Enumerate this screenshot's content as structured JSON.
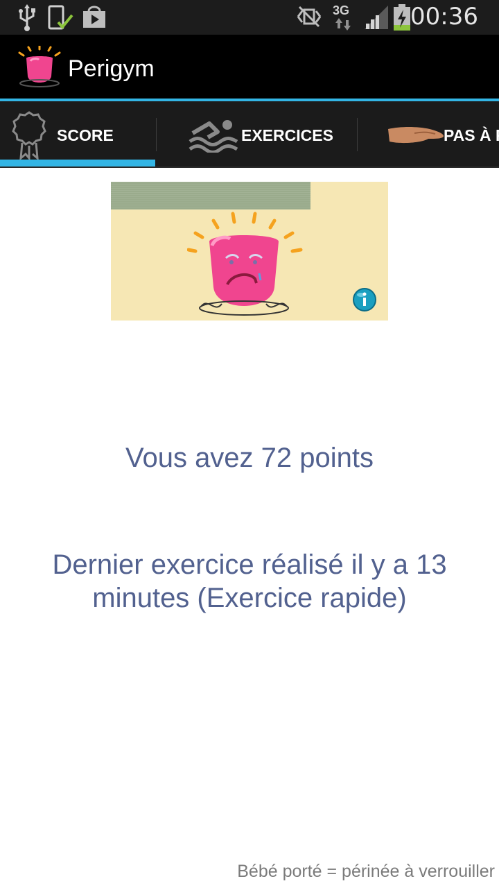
{
  "status_bar": {
    "time": "00:36",
    "network": "3G",
    "icons": [
      "usb-icon",
      "phone-check-icon",
      "play-store-icon",
      "no-signal-icon",
      "data-arrows-icon",
      "signal-strength-icon",
      "battery-charging-icon"
    ]
  },
  "app": {
    "title": "Perigym",
    "logo_icon": "perigym-logo-icon"
  },
  "tabs": [
    {
      "label": "SCORE",
      "icon": "ribbon-award-icon",
      "selected": true
    },
    {
      "label": "EXERCICES",
      "icon": "swimmer-icon",
      "selected": false
    },
    {
      "label": "PAS À F",
      "icon": "hand-icon",
      "selected": false
    }
  ],
  "banner": {
    "progress_fraction": 0.72,
    "character_icon": "sad-pink-mascot-icon",
    "info_icon": "info-icon"
  },
  "score": {
    "points_text": "Vous avez 72 points",
    "last_exercise_text": "Dernier exercice réalisé il y a 13 minutes (Exercice rapide)"
  },
  "footer": {
    "tip": "Bébé porté = périnée à verrouiller"
  },
  "colors": {
    "accent": "#33b5e5",
    "text_primary": "#52618f",
    "banner_bg": "#f6e7b4",
    "mascot_pink": "#f0458f"
  }
}
